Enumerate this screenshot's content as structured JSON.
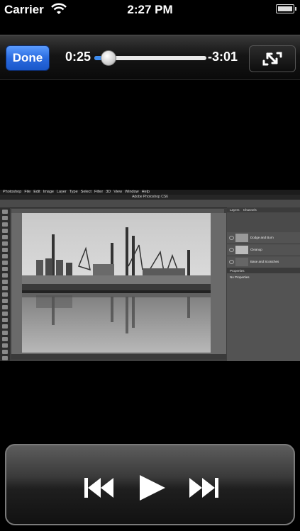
{
  "status_bar": {
    "carrier": "Carrier",
    "time": "2:27 PM"
  },
  "player": {
    "done_label": "Done",
    "elapsed": "0:25",
    "remaining": "-3:01",
    "progress_fraction": 0.12
  },
  "video": {
    "app_title": "Adobe Photoshop CS6",
    "menu": [
      "Photoshop",
      "File",
      "Edit",
      "Image",
      "Layer",
      "Type",
      "Select",
      "Filter",
      "3D",
      "View",
      "Window",
      "Help"
    ],
    "layers_tabs": [
      "Layers",
      "Channels"
    ],
    "layers": [
      "Dodge and Burn",
      "Cleanup",
      "Base and Scratches"
    ],
    "properties_title": "Properties",
    "properties_text": "No Properties"
  },
  "icons": {
    "wifi": "wifi-icon",
    "battery": "battery-icon",
    "fullscreen": "expand-icon",
    "previous": "skip-previous-icon",
    "play": "play-icon",
    "next": "skip-next-icon"
  },
  "colors": {
    "done_button": "#2a6be0",
    "played_track": "#3d8cf0"
  }
}
